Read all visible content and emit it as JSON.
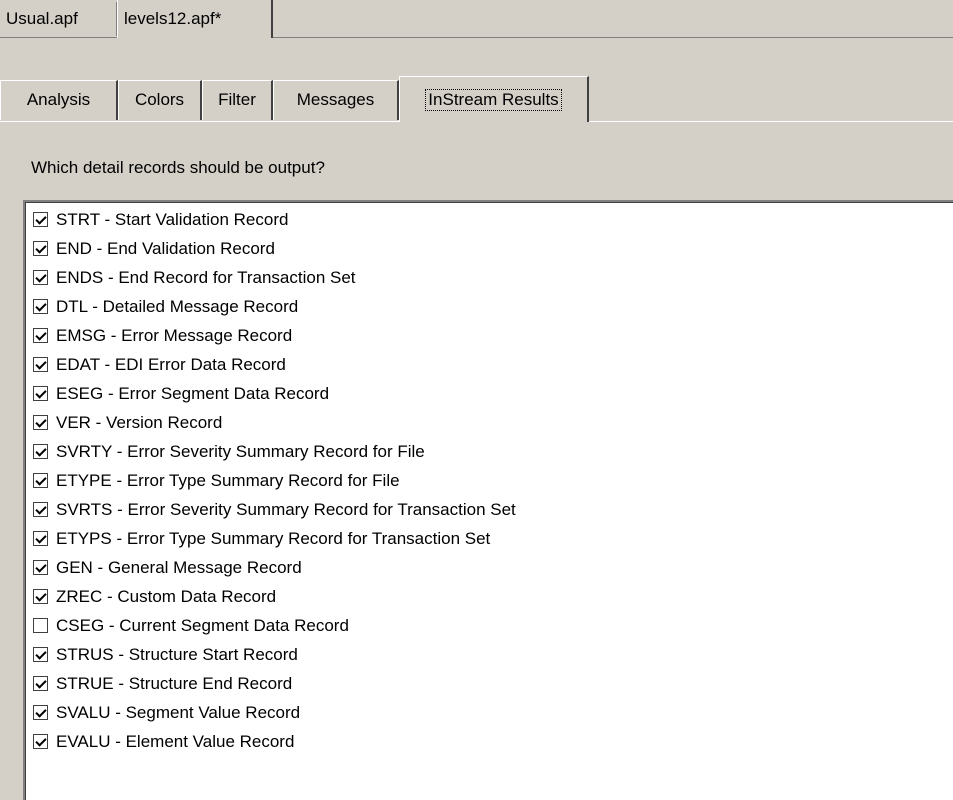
{
  "doc_tabs": [
    {
      "label": "Usual.apf",
      "active": false
    },
    {
      "label": "levels12.apf*",
      "active": true
    }
  ],
  "prop_tabs": [
    {
      "label": "Analysis",
      "active": false
    },
    {
      "label": "Colors",
      "active": false
    },
    {
      "label": "Filter",
      "active": false
    },
    {
      "label": "Messages",
      "active": false
    },
    {
      "label": "InStream Results",
      "active": true
    }
  ],
  "question": "Which detail records should be output?",
  "records": [
    {
      "label": "STRT - Start Validation Record",
      "checked": true
    },
    {
      "label": "END - End Validation Record",
      "checked": true
    },
    {
      "label": "ENDS - End Record for Transaction Set",
      "checked": true
    },
    {
      "label": "DTL - Detailed Message Record",
      "checked": true
    },
    {
      "label": "EMSG - Error Message Record",
      "checked": true
    },
    {
      "label": "EDAT - EDI Error Data Record",
      "checked": true
    },
    {
      "label": "ESEG - Error Segment Data Record",
      "checked": true
    },
    {
      "label": "VER - Version Record",
      "checked": true
    },
    {
      "label": "SVRTY - Error Severity Summary Record for File",
      "checked": true
    },
    {
      "label": "ETYPE - Error Type Summary Record for File",
      "checked": true
    },
    {
      "label": "SVRTS - Error Severity Summary Record for Transaction Set",
      "checked": true
    },
    {
      "label": "ETYPS - Error Type Summary Record for Transaction Set",
      "checked": true
    },
    {
      "label": "GEN - General Message Record",
      "checked": true
    },
    {
      "label": "ZREC - Custom Data Record",
      "checked": true
    },
    {
      "label": "CSEG - Current Segment Data Record",
      "checked": false
    },
    {
      "label": "STRUS - Structure Start Record",
      "checked": true
    },
    {
      "label": "STRUE - Structure End Record",
      "checked": true
    },
    {
      "label": "SVALU - Segment Value Record",
      "checked": true
    },
    {
      "label": "EVALU - Element Value Record",
      "checked": true
    }
  ]
}
